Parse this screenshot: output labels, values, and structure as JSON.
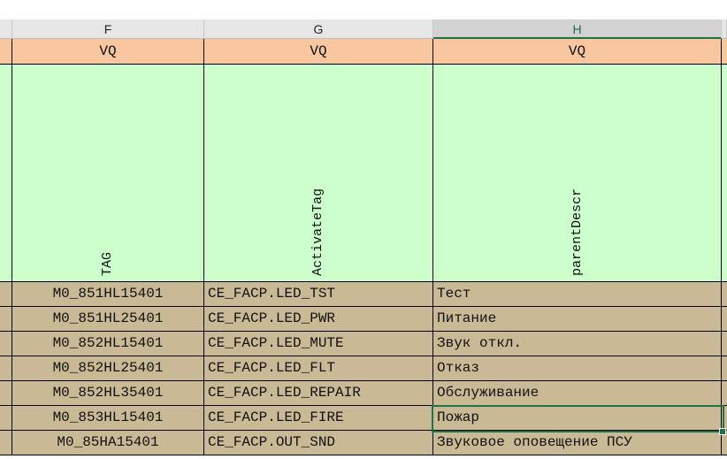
{
  "columns": [
    {
      "letter": "F",
      "selected": false
    },
    {
      "letter": "G",
      "selected": false
    },
    {
      "letter": "H",
      "selected": true
    }
  ],
  "type_row": [
    "VQ",
    "VQ",
    "VQ"
  ],
  "header_labels": [
    "TAG",
    "ActivateTag",
    "parentDescr"
  ],
  "rows": [
    [
      "M0_851HL15401",
      "CE_FACP.LED_TST",
      "Тест"
    ],
    [
      "M0_851HL25401",
      "CE_FACP.LED_PWR",
      "Питание"
    ],
    [
      "M0_852HL15401",
      "CE_FACP.LED_MUTE",
      "Звук откл."
    ],
    [
      "M0_852HL25401",
      "CE_FACP.LED_FLT",
      "Отказ"
    ],
    [
      "M0_852HL35401",
      "CE_FACP.LED_REPAIR",
      "Обслуживание"
    ],
    [
      "M0_853HL15401",
      "CE_FACP.LED_FIRE",
      "Пожар"
    ],
    [
      "M0_85HA15401",
      "CE_FACP.OUT_SND",
      "Звуковое оповещение ПСУ"
    ]
  ],
  "selected_cell": {
    "row": 5,
    "col": 2
  },
  "colors": {
    "type_row": "#f8c79f",
    "header": "#ccffcc",
    "data": "#c9b995",
    "selection": "#217346"
  }
}
